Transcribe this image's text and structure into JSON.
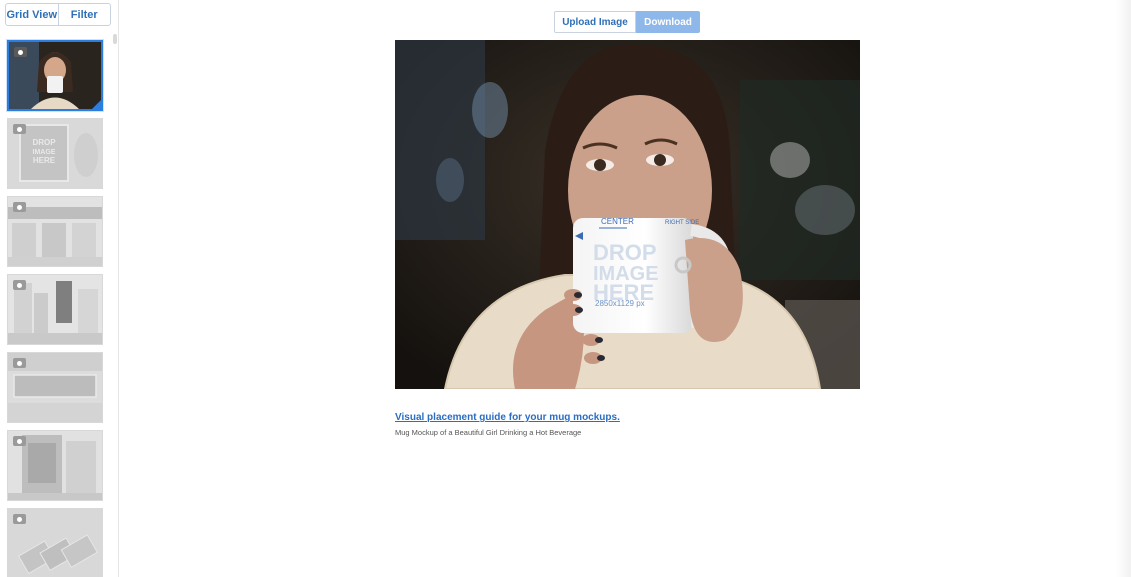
{
  "sidebar": {
    "grid_view_label": "Grid View",
    "filter_label": "Filter",
    "thumbnails": [
      {
        "scene": "girl drinking from mug",
        "selected": true
      },
      {
        "scene": "poster frame drop image here",
        "selected": false
      },
      {
        "scene": "storefront building",
        "selected": false
      },
      {
        "scene": "city billboard",
        "selected": false
      },
      {
        "scene": "street banner",
        "selected": false
      },
      {
        "scene": "bus stop poster",
        "selected": false
      },
      {
        "scene": "stacked cards",
        "selected": false
      }
    ]
  },
  "toolbar": {
    "upload_label": "Upload Image",
    "download_label": "Download"
  },
  "preview": {
    "mug": {
      "center_label": "CENTER",
      "right_side_label": "RIGHT SIDE",
      "drop_line1": "DROP",
      "drop_line2": "IMAGE",
      "drop_line3": "HERE",
      "size_label": "2850x1129 px"
    }
  },
  "guide_link": "Visual placement guide for your mug mockups.",
  "caption": "Mug Mockup of a Beautiful Girl Drinking a Hot Beverage",
  "colors": {
    "accent": "#2a7de1",
    "button_text": "#2f6fb7",
    "download_bg": "#8fb8ea",
    "link": "#2a6dc2"
  }
}
